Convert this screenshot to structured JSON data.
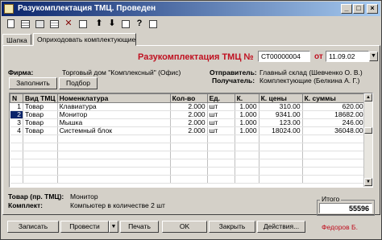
{
  "window": {
    "title": "Разукомплектация ТМЦ. Проведен",
    "min": "_",
    "max": "□",
    "close": "×"
  },
  "toolbar": {
    "icons": [
      "new-doc-icon",
      "table-icon",
      "save-icon",
      "print-preview-icon",
      "delete-icon",
      "structure-icon",
      "move-up-icon",
      "move-down-icon",
      "sort-icon",
      "help-icon",
      "options-icon"
    ]
  },
  "tabs": [
    {
      "label": "Шапка",
      "active": false
    },
    {
      "label": "Оприходовать комплектующие",
      "active": true
    }
  ],
  "header": {
    "doc_title": "Разукомплектация ТМЦ №",
    "doc_number": "СТ00000004",
    "date_prefix": "от",
    "date": "11.09.02",
    "firm_label": "Фирма:",
    "firm_value": "Торговый дом \"Комплексный\" (Офис)",
    "sender_label": "Отправитель:",
    "sender_value": "Главный склад (Шевченко О. В.)",
    "recipient_label": "Получатель:",
    "recipient_value": "Комплектующие (Белкина А. Г.)",
    "fill_button": "Заполнить",
    "select_button": "Подбор"
  },
  "table": {
    "columns": [
      "N",
      "Вид ТМЦ",
      "Номенклатура",
      "Кол-во",
      "Ед.",
      "К.",
      "К. цены",
      "К. суммы"
    ],
    "rows": [
      {
        "n": "1",
        "type": "Товар",
        "item": "Клавиатура",
        "qty": "2.000",
        "unit": "шт",
        "k": "1.000",
        "price": "310.00",
        "sum": "620.00"
      },
      {
        "n": "2",
        "type": "Товар",
        "item": "Монитор",
        "qty": "2.000",
        "unit": "шт",
        "k": "1.000",
        "price": "9341.00",
        "sum": "18682.00"
      },
      {
        "n": "3",
        "type": "Товар",
        "item": "Мышка",
        "qty": "2.000",
        "unit": "шт",
        "k": "1.000",
        "price": "123.00",
        "sum": "246.00"
      },
      {
        "n": "4",
        "type": "Товар",
        "item": "Системный блок",
        "qty": "2.000",
        "unit": "шт",
        "k": "1.000",
        "price": "18024.00",
        "sum": "36048.00"
      }
    ],
    "selected_row": 2
  },
  "footer": {
    "goods_label": "Товар (пр. ТМЦ):",
    "goods_value": "Монитор",
    "kit_label": "Комплект:",
    "kit_value": "Компьютер в количестве 2 шт",
    "total_label": "Итого",
    "total_value": "55596",
    "user": "Федоров Б."
  },
  "buttons": {
    "record": "Записать",
    "post": "Провести",
    "post_dropdown": "▼",
    "print": "Печать",
    "ok": "OK",
    "close": "Закрыть",
    "actions": "Действия..."
  },
  "colors": {
    "title_accent": "#c01020",
    "titlebar": "#0a246a",
    "face": "#d4d0c8"
  }
}
